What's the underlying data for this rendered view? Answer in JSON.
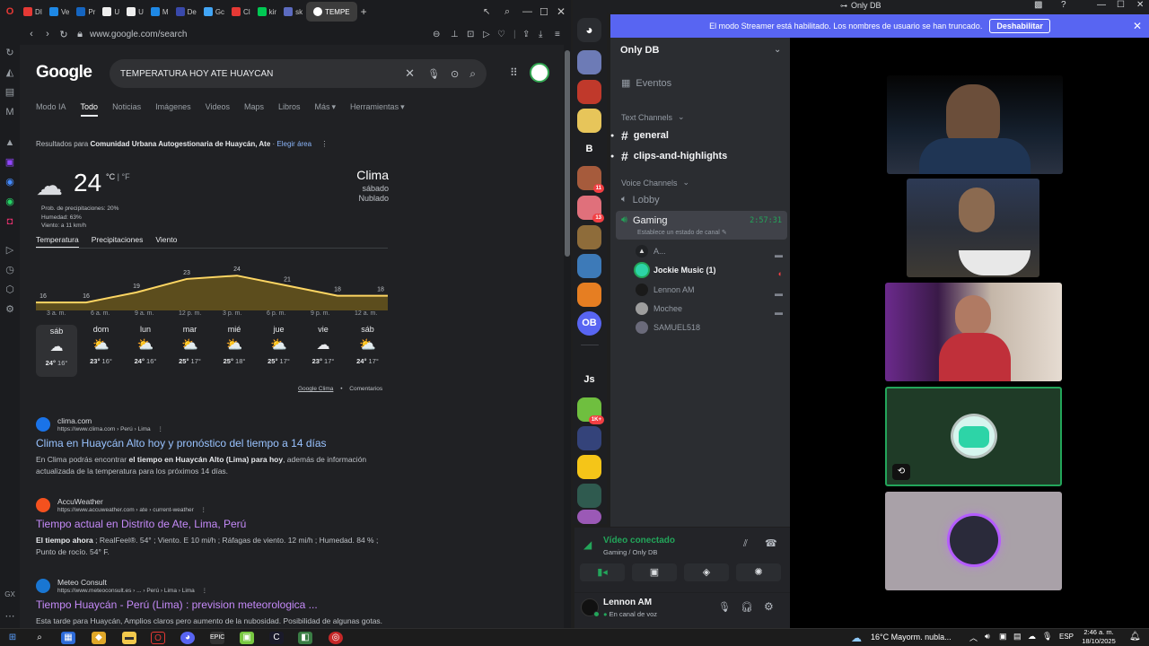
{
  "browser": {
    "tabs": [
      {
        "label": "DI",
        "color": "#e53935"
      },
      {
        "label": "Ve",
        "color": "#1e88e5"
      },
      {
        "label": "Pr",
        "color": "#1565c0"
      },
      {
        "label": "U",
        "color": "#eeeeee"
      },
      {
        "label": "U",
        "color": "#eeeeee"
      },
      {
        "label": "M",
        "color": "#1e88e5"
      },
      {
        "label": "De",
        "color": "#3949ab"
      },
      {
        "label": "Gc",
        "color": "#42a5f5"
      },
      {
        "label": "Cl",
        "color": "#e53935"
      },
      {
        "label": "kir",
        "color": "#00c853"
      },
      {
        "label": "sk",
        "color": "#5c6bc0"
      }
    ],
    "active_tab": "TEMPE",
    "url": "www.google.com/search"
  },
  "google": {
    "logo": "Google",
    "query": "TEMPERATURA HOY ATE HUAYCAN",
    "nav": [
      "Modo IA",
      "Todo",
      "Noticias",
      "Imágenes",
      "Videos",
      "Maps",
      "Libros",
      "Más",
      "Herramientas"
    ],
    "results_for_prefix": "Resultados para",
    "results_for_place": "Comunidad Urbana Autogestionaria de Huaycán, Ate",
    "choose_area": "Elegir área",
    "weather": {
      "temp": "24",
      "unit_c": "°C",
      "unit_sep": "|",
      "unit_f": "°F",
      "precip": "Prob. de precipitaciones: 20%",
      "humidity": "Humedad: 63%",
      "wind": "Viento: a 11 km/h",
      "title": "Clima",
      "day": "sábado",
      "condition": "Nublado",
      "tabs": [
        "Temperatura",
        "Precipitaciones",
        "Viento"
      ],
      "hour_labels": [
        "3 a. m.",
        "6 a. m.",
        "9 a. m.",
        "12 p. m.",
        "3 p. m.",
        "6 p. m.",
        "9 p. m.",
        "12 a. m."
      ],
      "chart_data": {
        "type": "area",
        "x": [
          "3 a. m.",
          "6 a. m.",
          "9 a. m.",
          "12 p. m.",
          "3 p. m.",
          "6 p. m.",
          "9 p. m.",
          "12 a. m."
        ],
        "values": [
          16,
          16,
          19,
          23,
          24,
          21,
          18,
          18
        ],
        "ylim": [
          12,
          27
        ],
        "color": "#fdd663"
      },
      "days": [
        {
          "name": "sáb",
          "icon": "☁",
          "hi": "24°",
          "lo": "16°"
        },
        {
          "name": "dom",
          "icon": "⛅",
          "hi": "23°",
          "lo": "16°"
        },
        {
          "name": "lun",
          "icon": "⛅",
          "hi": "24°",
          "lo": "16°"
        },
        {
          "name": "mar",
          "icon": "⛅",
          "hi": "25°",
          "lo": "17°"
        },
        {
          "name": "mié",
          "icon": "⛅",
          "hi": "25°",
          "lo": "18°"
        },
        {
          "name": "jue",
          "icon": "⛅",
          "hi": "25°",
          "lo": "17°"
        },
        {
          "name": "vie",
          "icon": "☁",
          "hi": "23°",
          "lo": "17°"
        },
        {
          "name": "sáb",
          "icon": "⛅",
          "hi": "24°",
          "lo": "17°"
        }
      ],
      "footer_link": "Google Clima",
      "footer_sep": "•",
      "footer_feedback": "Comentarios"
    },
    "results": [
      {
        "site": "clima.com",
        "url": "https://www.clima.com › Perú › Lima",
        "title": "Clima en Huaycán Alto hoy y pronóstico del tiempo a 14 días",
        "snippet_pre": "En Clima podrás encontrar ",
        "snippet_bold": "el tiempo en Huaycán Alto (Lima) para hoy",
        "snippet_post": ", además de información actualizada de la temperatura para los próximos 14 días.",
        "favicon": "#1a73e8"
      },
      {
        "site": "AccuWeather",
        "url": "https://www.accuweather.com › ate › current-weather",
        "title": "Tiempo actual en Distrito de Ate, Lima, Perú",
        "snippet_pre": "",
        "snippet_bold": "El tiempo ahora",
        "snippet_post": " ; RealFeel®. 54° ; Viento. E 10 mi/h ; Ráfagas de viento. 12 mi/h ; Humedad. 84 % ; Punto de rocío. 54° F.",
        "favicon": "#f4511e"
      },
      {
        "site": "Meteo Consult",
        "url": "https://www.meteoconsult.es › ... › Perú › Lima › Lima",
        "title": "Tiempo Huaycán - Perú (Lima) : prevision meteorologica ...",
        "snippet_pre": "Esta tarde para Huaycán, Amplios claros pero aumento de la nubosidad. Posibilidad de algunas gotas.",
        "snippet_bold": "",
        "snippet_post": "",
        "favicon": "#1976d2"
      }
    ]
  },
  "discord": {
    "window_title": "Only DB",
    "banner_text": "El modo Streamer está habilitado. Los nombres de usuario se han truncado.",
    "banner_button": "Deshabilitar",
    "server_name": "Only DB",
    "events": "Eventos",
    "text_category": "Text Channels",
    "text_channels": [
      "general",
      "clips-and-highlights"
    ],
    "voice_category": "Voice Channels",
    "lobby": "Lobby",
    "gaming": "Gaming",
    "gaming_timer": "2:57:31",
    "gaming_status": "Establece un estado de canal",
    "members": [
      "A...",
      "Jockie Music (1)",
      "Lennon AM",
      "Mochee",
      "SAMUEL518"
    ],
    "guild_labels": [
      "B",
      "OB",
      "Js"
    ],
    "guild_badges": [
      "11",
      "13",
      "1K+"
    ],
    "voice_connected": "Vídeo conectado",
    "voice_location": "Gaming / Only DB",
    "user_name": "Lennon AM",
    "user_status": "En canal de voz",
    "colors": {
      "blurple": "#5865f2",
      "green": "#23a55a",
      "red": "#f23f43"
    }
  },
  "taskbar": {
    "weather": "16°C  Mayorm. nubla...",
    "lang": "ESP",
    "time": "2:46 a. m.",
    "date": "18/10/2025"
  }
}
